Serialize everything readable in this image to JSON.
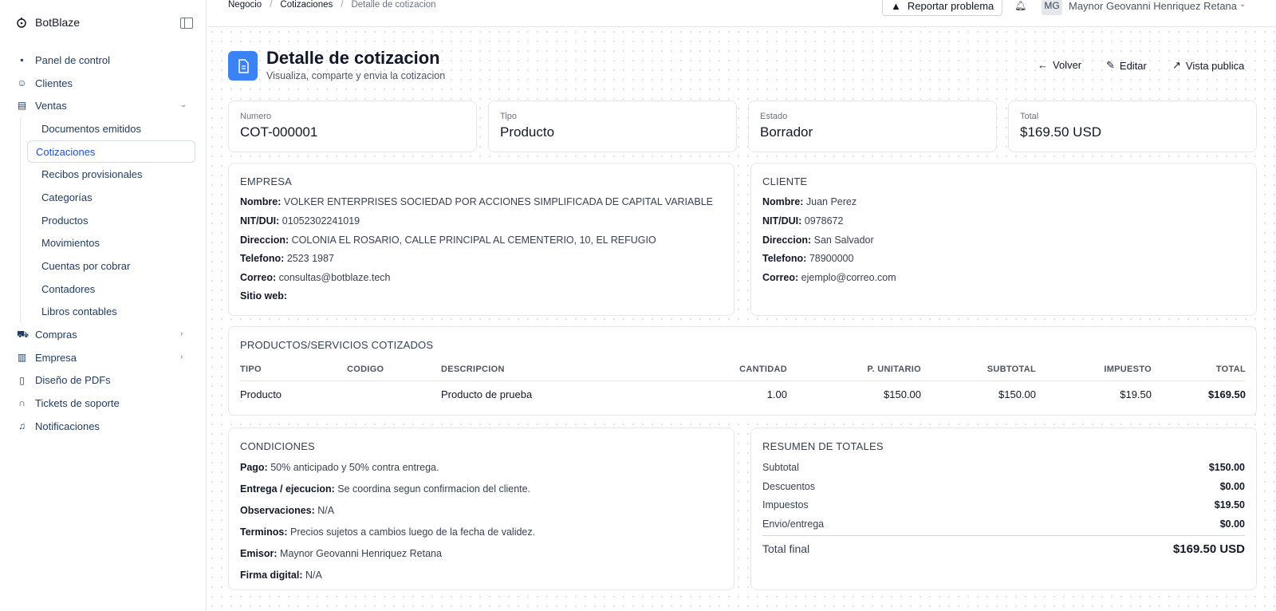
{
  "brand": {
    "name": "BotBlaze"
  },
  "sidebar": {
    "items": [
      {
        "label": "Panel de control",
        "icon": "grid-icon"
      },
      {
        "label": "Clientes",
        "icon": "users-icon"
      },
      {
        "label": "Ventas",
        "icon": "receipt-icon"
      },
      {
        "label": "Compras",
        "icon": "cart-icon"
      },
      {
        "label": "Empresa",
        "icon": "building-icon"
      },
      {
        "label": "Diseño de PDFs",
        "icon": "file-icon"
      },
      {
        "label": "Tickets de soporte",
        "icon": "headset-icon"
      },
      {
        "label": "Notificaciones",
        "icon": "bell-icon"
      }
    ],
    "ventas_sub": [
      "Documentos emitidos",
      "Cotizaciones",
      "Recibos provisionales",
      "Categorías",
      "Productos",
      "Movimientos",
      "Cuentas por cobrar",
      "Contadores",
      "Libros contables"
    ]
  },
  "topbar": {
    "crumbs": [
      "Negocio",
      "Cotizaciones",
      "Detalle de cotizacion"
    ],
    "report_label": "Reportar problema",
    "avatar_initials": "MG",
    "user_name": "Maynor Geovanni Henriquez Retana"
  },
  "page": {
    "title": "Detalle de cotizacion",
    "subtitle": "Visualiza, comparte y envia la cotizacion",
    "actions": {
      "back": "Volver",
      "edit": "Editar",
      "public": "Vista publica"
    }
  },
  "stats": [
    {
      "label": "Numero",
      "value": "COT-000001"
    },
    {
      "label": "Tipo",
      "value": "Producto"
    },
    {
      "label": "Estado",
      "value": "Borrador"
    },
    {
      "label": "Total",
      "value": "$169.50 USD"
    }
  ],
  "empresa": {
    "title": "EMPRESA",
    "fields": [
      {
        "k": "Nombre:",
        "v": "VOLKER ENTERPRISES SOCIEDAD POR ACCIONES SIMPLIFICADA DE CAPITAL VARIABLE"
      },
      {
        "k": "NIT/DUI:",
        "v": "01052302241019"
      },
      {
        "k": "Direccion:",
        "v": "COLONIA EL ROSARIO, CALLE PRINCIPAL AL CEMENTERIO, 10, EL REFUGIO"
      },
      {
        "k": "Telefono:",
        "v": "2523 1987"
      },
      {
        "k": "Correo:",
        "v": "consultas@botblaze.tech"
      },
      {
        "k": "Sitio web:",
        "v": ""
      }
    ]
  },
  "cliente": {
    "title": "CLIENTE",
    "fields": [
      {
        "k": "Nombre:",
        "v": "Juan Perez"
      },
      {
        "k": "NIT/DUI:",
        "v": "0978672"
      },
      {
        "k": "Direccion:",
        "v": "San Salvador"
      },
      {
        "k": "Telefono:",
        "v": "78900000"
      },
      {
        "k": "Correo:",
        "v": "ejemplo@correo.com"
      }
    ]
  },
  "productos": {
    "title": "PRODUCTOS/SERVICIOS COTIZADOS",
    "headers": [
      "TIPO",
      "CODIGO",
      "DESCRIPCION",
      "CANTIDAD",
      "P. UNITARIO",
      "SUBTOTAL",
      "IMPUESTO",
      "TOTAL"
    ],
    "rows": [
      [
        "Producto",
        "",
        "Producto de prueba",
        "1.00",
        "$150.00",
        "$150.00",
        "$19.50",
        "$169.50"
      ]
    ]
  },
  "condiciones": {
    "title": "CONDICIONES",
    "fields": [
      {
        "k": "Pago:",
        "v": "50% anticipado y 50% contra entrega."
      },
      {
        "k": "Entrega / ejecucion:",
        "v": "Se coordina segun confirmacion del cliente."
      },
      {
        "k": "Observaciones:",
        "v": "N/A"
      },
      {
        "k": "Terminos:",
        "v": "Precios sujetos a cambios luego de la fecha de validez."
      },
      {
        "k": "Emisor:",
        "v": "Maynor Geovanni Henriquez Retana"
      },
      {
        "k": "Firma digital:",
        "v": "N/A"
      }
    ]
  },
  "resumen": {
    "title": "RESUMEN DE TOTALES",
    "rows": [
      {
        "k": "Subtotal",
        "v": "$150.00"
      },
      {
        "k": "Descuentos",
        "v": "$0.00"
      },
      {
        "k": "Impuestos",
        "v": "$19.50"
      },
      {
        "k": "Envio/entrega",
        "v": "$0.00"
      }
    ],
    "final_label": "Total final",
    "final_value": "$169.50 USD"
  },
  "colors": {
    "accent": "#3b82f6",
    "active_link": "#1d4ed8"
  }
}
